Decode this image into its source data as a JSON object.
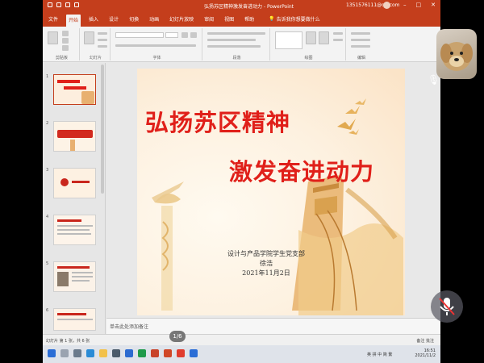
{
  "window": {
    "title": "弘扬苏区精神激发奋进动力 - PowerPoint",
    "user": "1351576111@qq.com"
  },
  "tabs": [
    {
      "label": "文件"
    },
    {
      "label": "开始"
    },
    {
      "label": "插入"
    },
    {
      "label": "设计"
    },
    {
      "label": "切换"
    },
    {
      "label": "动画"
    },
    {
      "label": "幻灯片放映"
    },
    {
      "label": "审阅"
    },
    {
      "label": "视图"
    },
    {
      "label": "帮助"
    }
  ],
  "tell_me": "告诉我你想要做什么",
  "ribbon": {
    "groups": [
      "剪贴板",
      "幻灯片",
      "字体",
      "段落",
      "绘图",
      "编辑"
    ]
  },
  "thumbnails": [
    {
      "num": "1"
    },
    {
      "num": "2"
    },
    {
      "num": "3"
    },
    {
      "num": "4"
    },
    {
      "num": "5"
    },
    {
      "num": "6"
    }
  ],
  "slide": {
    "title_line1": "弘扬苏区精神",
    "title_line2": "激发奋进动力",
    "org": "设计与产品学院学生党支部",
    "name": "徐浩",
    "date": "2021年11月2日"
  },
  "notes": "单击此处添加备注",
  "pager": "1/6",
  "statusbar": {
    "left": "幻灯片 第 1 张，共 6 张",
    "right": "备注 批注"
  },
  "taskbar": {
    "ime": "英 拼 中 简 繁",
    "time": "16:51",
    "date": "2021/11/2"
  },
  "colors": {
    "accent": "#c43e1c",
    "title_red": "#e0201a"
  }
}
